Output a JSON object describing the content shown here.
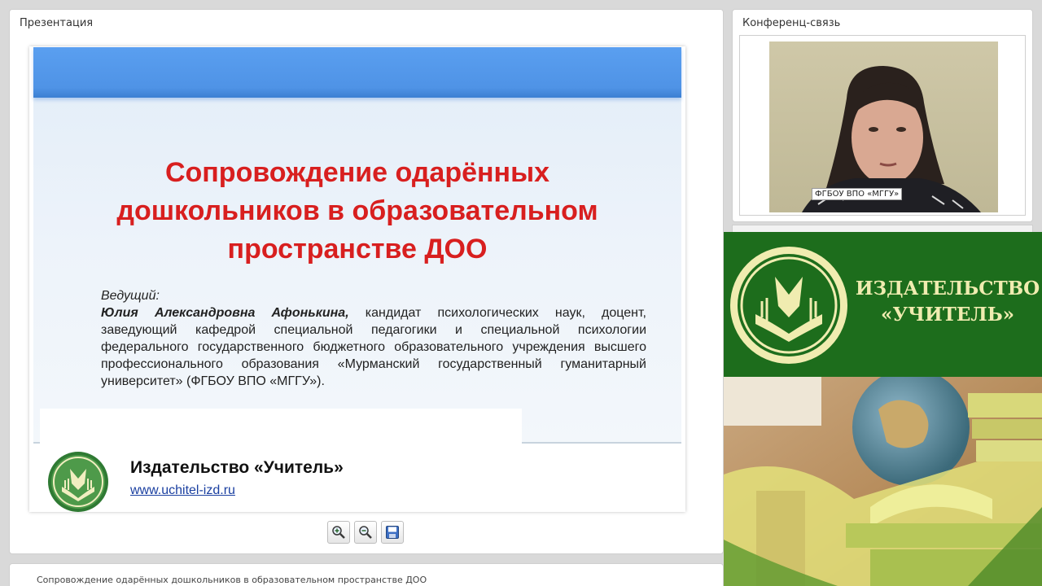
{
  "presentation": {
    "panel_title": "Презентация",
    "slide": {
      "title_lines": [
        "Сопровождение одарённых",
        "дошкольников в образовательном",
        "пространстве ДОО"
      ],
      "presenter_label": "Ведущий:",
      "presenter_name": "Юлия Александровна Афонькина,",
      "presenter_description": "кандидат психологических наук, доцент, заведующий кафедрой специальной педагогики и специальной психологии федерального государственного бюджетного образовательного учреждения высшего профессионального образования «Мурманский государственный гуманитарный университет» (ФГБОУ ВПО «МГГУ»).",
      "publisher": "Издательство «Учитель»",
      "url": "www.uchitel-izd.ru"
    },
    "toolbar": {
      "zoom_in_icon": "zoom-in-icon",
      "zoom_out_icon": "zoom-out-icon",
      "save_icon": "save-icon"
    }
  },
  "bottom_bar": {
    "text": "Сопровождение одарённых дошкольников в образовательном пространстве ДОО"
  },
  "conference": {
    "panel_title": "Конференц-связь",
    "video_label": "ФГБОУ ВПО «МГГУ»"
  },
  "ad": {
    "line1": "ИЗДАТЕЛЬСТВО",
    "line2": "«УЧИТЕЛЬ»",
    "brand_green": "#1d6d1c",
    "brand_cream": "#f0ecb0"
  },
  "colors": {
    "title_red": "#d81f1f",
    "band_blue": "#4f93e6",
    "link_blue": "#1a3fa0"
  }
}
